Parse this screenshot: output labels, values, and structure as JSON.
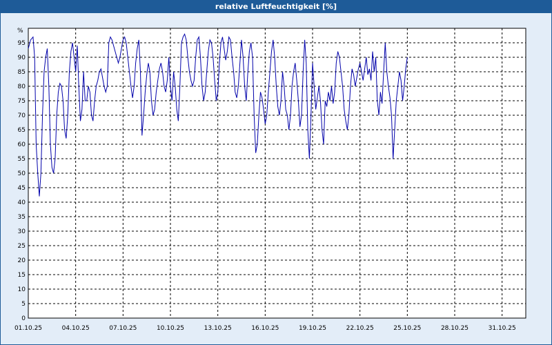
{
  "window": {
    "title": "relative Luftfeuchtigkeit [%]"
  },
  "colors": {
    "titlebar": "#1e5b98",
    "background": "#e3edf8",
    "line": "#0000aa",
    "grid": "#000000"
  },
  "chart_data": {
    "type": "line",
    "title": "relative Luftfeuchtigkeit [%]",
    "ylabel": "%",
    "xlabel": "",
    "ylim": [
      0,
      100
    ],
    "yticks": [
      0,
      5,
      10,
      15,
      20,
      25,
      30,
      35,
      40,
      45,
      50,
      55,
      60,
      65,
      70,
      75,
      80,
      85,
      90,
      95
    ],
    "xlim": [
      0,
      31.5
    ],
    "xticks": [
      {
        "x": 0,
        "label": "01.10.25"
      },
      {
        "x": 3,
        "label": "04.10.25"
      },
      {
        "x": 6,
        "label": "07.10.25"
      },
      {
        "x": 9,
        "label": "10.10.25"
      },
      {
        "x": 12,
        "label": "13.10.25"
      },
      {
        "x": 15,
        "label": "16.10.25"
      },
      {
        "x": 18,
        "label": "19.10.25"
      },
      {
        "x": 21,
        "label": "22.10.25"
      },
      {
        "x": 24,
        "label": "25.10.25"
      },
      {
        "x": 27,
        "label": "28.10.25"
      },
      {
        "x": 30,
        "label": "31.10.25"
      }
    ],
    "grid": true,
    "series": [
      {
        "points": [
          [
            0.0,
            93
          ],
          [
            0.15,
            96
          ],
          [
            0.3,
            97
          ],
          [
            0.4,
            90
          ],
          [
            0.5,
            60
          ],
          [
            0.6,
            50
          ],
          [
            0.7,
            42
          ],
          [
            0.8,
            50
          ],
          [
            0.9,
            70
          ],
          [
            1.0,
            85
          ],
          [
            1.1,
            90
          ],
          [
            1.2,
            93
          ],
          [
            1.3,
            80
          ],
          [
            1.4,
            60
          ],
          [
            1.5,
            52
          ],
          [
            1.6,
            50
          ],
          [
            1.7,
            55
          ],
          [
            1.8,
            70
          ],
          [
            1.9,
            78
          ],
          [
            2.0,
            81
          ],
          [
            2.1,
            80
          ],
          [
            2.2,
            75
          ],
          [
            2.3,
            65
          ],
          [
            2.4,
            62
          ],
          [
            2.5,
            70
          ],
          [
            2.6,
            85
          ],
          [
            2.7,
            92
          ],
          [
            2.8,
            95
          ],
          [
            2.9,
            90
          ],
          [
            3.0,
            85
          ],
          [
            3.1,
            94
          ],
          [
            3.2,
            80
          ],
          [
            3.3,
            68
          ],
          [
            3.4,
            72
          ],
          [
            3.5,
            85
          ],
          [
            3.6,
            75
          ],
          [
            3.7,
            75
          ],
          [
            3.8,
            80
          ],
          [
            3.9,
            78
          ],
          [
            4.0,
            70
          ],
          [
            4.1,
            68
          ],
          [
            4.2,
            75
          ],
          [
            4.3,
            80
          ],
          [
            4.4,
            82
          ],
          [
            4.5,
            85
          ],
          [
            4.6,
            86
          ],
          [
            4.7,
            83
          ],
          [
            4.8,
            80
          ],
          [
            4.9,
            78
          ],
          [
            5.0,
            80
          ],
          [
            5.1,
            95
          ],
          [
            5.2,
            97
          ],
          [
            5.3,
            96
          ],
          [
            5.4,
            94
          ],
          [
            5.5,
            92
          ],
          [
            5.6,
            90
          ],
          [
            5.7,
            88
          ],
          [
            5.8,
            90
          ],
          [
            5.9,
            93
          ],
          [
            6.0,
            96
          ],
          [
            6.1,
            97
          ],
          [
            6.2,
            95
          ],
          [
            6.3,
            90
          ],
          [
            6.4,
            85
          ],
          [
            6.5,
            80
          ],
          [
            6.6,
            76
          ],
          [
            6.7,
            80
          ],
          [
            6.8,
            88
          ],
          [
            6.9,
            93
          ],
          [
            7.0,
            96
          ],
          [
            7.1,
            85
          ],
          [
            7.2,
            63
          ],
          [
            7.3,
            70
          ],
          [
            7.4,
            78
          ],
          [
            7.5,
            84
          ],
          [
            7.6,
            88
          ],
          [
            7.7,
            85
          ],
          [
            7.8,
            75
          ],
          [
            7.9,
            70
          ],
          [
            8.0,
            72
          ],
          [
            8.1,
            78
          ],
          [
            8.2,
            82
          ],
          [
            8.3,
            86
          ],
          [
            8.4,
            88
          ],
          [
            8.5,
            85
          ],
          [
            8.6,
            80
          ],
          [
            8.7,
            78
          ],
          [
            8.8,
            82
          ],
          [
            8.9,
            90
          ],
          [
            9.0,
            80
          ],
          [
            9.1,
            75
          ],
          [
            9.2,
            85
          ],
          [
            9.3,
            80
          ],
          [
            9.4,
            72
          ],
          [
            9.5,
            68
          ],
          [
            9.6,
            80
          ],
          [
            9.7,
            95
          ],
          [
            9.8,
            97
          ],
          [
            9.9,
            98
          ],
          [
            10.0,
            96
          ],
          [
            10.1,
            90
          ],
          [
            10.2,
            85
          ],
          [
            10.3,
            82
          ],
          [
            10.4,
            80
          ],
          [
            10.5,
            82
          ],
          [
            10.6,
            90
          ],
          [
            10.7,
            96
          ],
          [
            10.8,
            97
          ],
          [
            10.9,
            90
          ],
          [
            11.0,
            80
          ],
          [
            11.1,
            75
          ],
          [
            11.2,
            78
          ],
          [
            11.3,
            85
          ],
          [
            11.4,
            92
          ],
          [
            11.5,
            96
          ],
          [
            11.6,
            95
          ],
          [
            11.7,
            90
          ],
          [
            11.8,
            82
          ],
          [
            11.9,
            75
          ],
          [
            12.0,
            78
          ],
          [
            12.1,
            88
          ],
          [
            12.2,
            95
          ],
          [
            12.3,
            97
          ],
          [
            12.4,
            93
          ],
          [
            12.5,
            89
          ],
          [
            12.6,
            92
          ],
          [
            12.7,
            97
          ],
          [
            12.8,
            96
          ],
          [
            12.9,
            90
          ],
          [
            13.0,
            85
          ],
          [
            13.1,
            78
          ],
          [
            13.2,
            76
          ],
          [
            13.3,
            80
          ],
          [
            13.4,
            88
          ],
          [
            13.5,
            96
          ],
          [
            13.6,
            90
          ],
          [
            13.7,
            80
          ],
          [
            13.8,
            75
          ],
          [
            13.9,
            85
          ],
          [
            14.0,
            92
          ],
          [
            14.1,
            95
          ],
          [
            14.2,
            90
          ],
          [
            14.3,
            70
          ],
          [
            14.4,
            57
          ],
          [
            14.5,
            60
          ],
          [
            14.6,
            70
          ],
          [
            14.7,
            78
          ],
          [
            14.8,
            76
          ],
          [
            14.9,
            72
          ],
          [
            15.0,
            67
          ],
          [
            15.1,
            70
          ],
          [
            15.2,
            78
          ],
          [
            15.3,
            85
          ],
          [
            15.4,
            92
          ],
          [
            15.5,
            96
          ],
          [
            15.6,
            90
          ],
          [
            15.7,
            80
          ],
          [
            15.8,
            73
          ],
          [
            15.9,
            70
          ],
          [
            16.0,
            75
          ],
          [
            16.1,
            85
          ],
          [
            16.2,
            80
          ],
          [
            16.3,
            72
          ],
          [
            16.4,
            70
          ],
          [
            16.5,
            65
          ],
          [
            16.6,
            70
          ],
          [
            16.7,
            80
          ],
          [
            16.8,
            85
          ],
          [
            16.9,
            88
          ],
          [
            17.0,
            82
          ],
          [
            17.1,
            75
          ],
          [
            17.2,
            66
          ],
          [
            17.3,
            70
          ],
          [
            17.4,
            85
          ],
          [
            17.5,
            96
          ],
          [
            17.6,
            88
          ],
          [
            17.7,
            65
          ],
          [
            17.8,
            55
          ],
          [
            17.9,
            70
          ],
          [
            18.0,
            88
          ],
          [
            18.1,
            80
          ],
          [
            18.2,
            72
          ],
          [
            18.3,
            76
          ],
          [
            18.4,
            80
          ],
          [
            18.5,
            75
          ],
          [
            18.6,
            65
          ],
          [
            18.7,
            60
          ],
          [
            18.8,
            75
          ],
          [
            18.9,
            73
          ],
          [
            19.0,
            78
          ],
          [
            19.1,
            75
          ],
          [
            19.2,
            80
          ],
          [
            19.3,
            74
          ],
          [
            19.4,
            78
          ],
          [
            19.5,
            88
          ],
          [
            19.6,
            92
          ],
          [
            19.7,
            90
          ],
          [
            19.8,
            85
          ],
          [
            19.9,
            80
          ],
          [
            20.0,
            72
          ],
          [
            20.1,
            68
          ],
          [
            20.2,
            65
          ],
          [
            20.3,
            70
          ],
          [
            20.4,
            80
          ],
          [
            20.5,
            86
          ],
          [
            20.6,
            84
          ],
          [
            20.7,
            80
          ],
          [
            20.8,
            83
          ],
          [
            20.9,
            86
          ],
          [
            21.0,
            88
          ],
          [
            21.1,
            85
          ],
          [
            21.2,
            82
          ],
          [
            21.3,
            86
          ],
          [
            21.4,
            90
          ],
          [
            21.5,
            84
          ],
          [
            21.6,
            86
          ],
          [
            21.7,
            82
          ],
          [
            21.8,
            92
          ],
          [
            21.9,
            85
          ],
          [
            22.0,
            90
          ],
          [
            22.1,
            75
          ],
          [
            22.2,
            70
          ],
          [
            22.3,
            78
          ],
          [
            22.4,
            74
          ],
          [
            22.5,
            85
          ],
          [
            22.6,
            95
          ],
          [
            22.7,
            85
          ],
          [
            22.8,
            80
          ],
          [
            22.9,
            76
          ],
          [
            23.0,
            70
          ],
          [
            23.1,
            55
          ],
          [
            23.2,
            65
          ],
          [
            23.3,
            75
          ],
          [
            23.4,
            80
          ],
          [
            23.5,
            85
          ],
          [
            23.6,
            82
          ],
          [
            23.7,
            75
          ],
          [
            23.8,
            80
          ],
          [
            23.9,
            86
          ],
          [
            24.0,
            90
          ]
        ]
      }
    ]
  }
}
